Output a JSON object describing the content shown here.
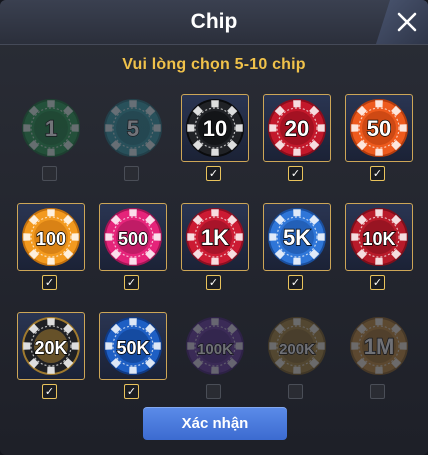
{
  "dialog": {
    "title": "Chip",
    "subtitle": "Vui lòng chọn 5-10 chip",
    "confirm_label": "Xác nhận"
  },
  "chips": [
    {
      "label": "1",
      "color": "#1f9a4a",
      "edge": "#0f6b30",
      "state": "disabled",
      "checked": false
    },
    {
      "label": "5",
      "color": "#2c9aa7",
      "edge": "#1d6c78",
      "state": "disabled",
      "checked": false
    },
    {
      "label": "10",
      "color": "#202226",
      "edge": "#0a0b0d",
      "state": "available",
      "checked": true
    },
    {
      "label": "20",
      "color": "#c3182b",
      "edge": "#8a0d1c",
      "state": "available",
      "checked": true
    },
    {
      "label": "50",
      "color": "#ee5a1d",
      "edge": "#b43c0d",
      "state": "available",
      "checked": true
    },
    {
      "label": "100",
      "color": "#f39a1f",
      "edge": "#c2700d",
      "state": "available",
      "checked": true
    },
    {
      "label": "500",
      "color": "#e5247a",
      "edge": "#a31555",
      "state": "available",
      "checked": true
    },
    {
      "label": "1K",
      "color": "#cc1b33",
      "edge": "#8c0f22",
      "state": "available",
      "checked": true
    },
    {
      "label": "5K",
      "color": "#2f76d8",
      "edge": "#1a4f9e",
      "state": "available",
      "checked": true
    },
    {
      "label": "10K",
      "color": "#b81b2a",
      "edge": "#7e0f1b",
      "state": "available",
      "checked": true
    },
    {
      "label": "20K",
      "color": "#1f2024",
      "edge": "#a07a2e",
      "state": "available",
      "checked": true
    },
    {
      "label": "50K",
      "color": "#1e5fc4",
      "edge": "#0f3a85",
      "state": "available",
      "checked": true
    },
    {
      "label": "100K",
      "color": "#6b3aa8",
      "edge": "#47217a",
      "state": "disabled",
      "checked": false
    },
    {
      "label": "200K",
      "color": "#b08a3c",
      "edge": "#7e5f22",
      "state": "disabled",
      "checked": false
    },
    {
      "label": "1M",
      "color": "#c98f3a",
      "edge": "#8f6222",
      "state": "disabled",
      "checked": false
    }
  ],
  "icons": {
    "close": "close-icon",
    "checkmark": "✓"
  }
}
